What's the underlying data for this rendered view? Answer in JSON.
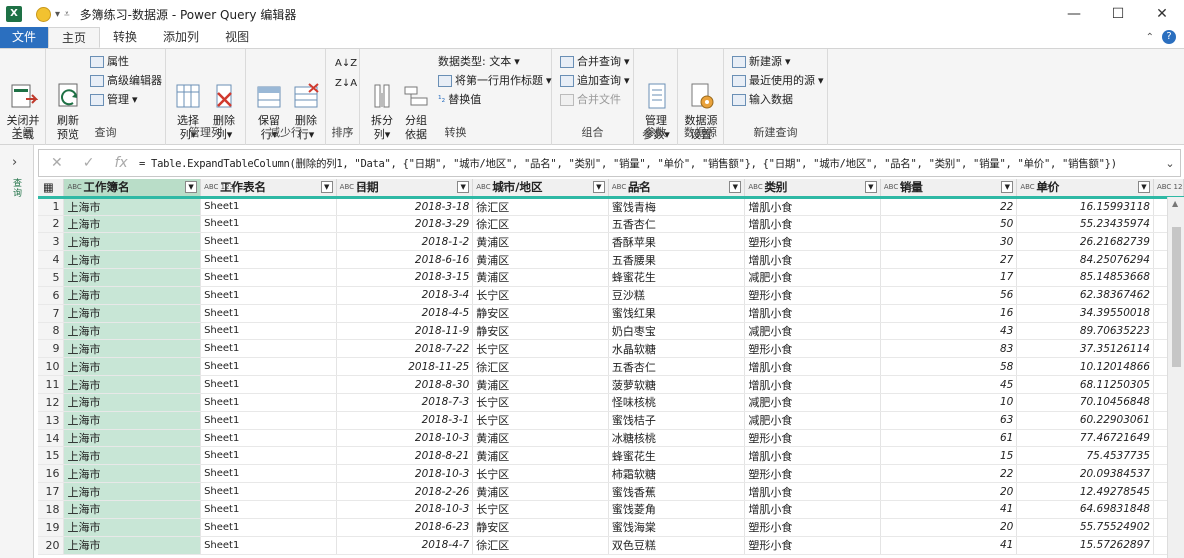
{
  "window": {
    "title": "多簿练习-数据源 - Power Query 编辑器",
    "app_icon": "X"
  },
  "tabs": [
    {
      "label": "文件"
    },
    {
      "label": "主页"
    },
    {
      "label": "转换"
    },
    {
      "label": "添加列"
    },
    {
      "label": "视图"
    }
  ],
  "ribbon": {
    "close_load": "关闭并\n上载",
    "close_group": "关闭",
    "refresh_preview": "刷新\n预览",
    "properties": "属性",
    "advanced_editor": "高级编辑器",
    "manage": "管理",
    "query_group": "查询",
    "choose_columns": "选择\n列",
    "remove_columns": "删除\n列",
    "manage_columns_group": "管理列",
    "keep_rows": "保留\n行",
    "remove_rows": "删除\n行",
    "reduce_rows_group": "减少行",
    "sort_group": "排序",
    "split_column": "拆分\n列",
    "group_by": "分组\n依据",
    "data_type": "数据类型: 文本",
    "first_row_header": "将第一行用作标题",
    "replace_values": "替换值",
    "transform_group": "转换",
    "merge_queries": "合并查询",
    "append_queries": "追加查询",
    "merge_files": "合并文件",
    "combine_group": "组合",
    "manage_params": "管理\n参数",
    "params_group": "参数",
    "data_source_settings": "数据源\n设置",
    "data_source_group": "数据源",
    "new_source": "新建源",
    "recent_sources": "最近使用的源",
    "enter_data": "输入数据",
    "new_query_group": "新建查询"
  },
  "left_pane": {
    "label": "查询"
  },
  "formula": "= Table.ExpandTableColumn(删除的列1, \"Data\", {\"日期\", \"城市/地区\", \"品名\", \"类别\", \"销量\", \"单价\", \"销售额\"}, {\"日期\", \"城市/地区\", \"品名\", \"类别\", \"销量\", \"单价\", \"销售额\"})",
  "columns": [
    {
      "type": "ABC",
      "name": "工作簿名"
    },
    {
      "type": "ABC 123",
      "name": "工作表名"
    },
    {
      "type": "ABC 123",
      "name": "日期"
    },
    {
      "type": "ABC 123",
      "name": "城市/地区"
    },
    {
      "type": "ABC 123",
      "name": "品名"
    },
    {
      "type": "ABC 123",
      "name": "类别"
    },
    {
      "type": "ABC 123",
      "name": "销量"
    },
    {
      "type": "ABC 123",
      "name": "单价"
    },
    {
      "type": "ABC 123",
      "name": ""
    }
  ],
  "rows": [
    [
      "1",
      "上海市",
      "Sheet1",
      "2018-3-18",
      "徐汇区",
      "蜜饯青梅",
      "增肌小食",
      "22",
      "16.15993118"
    ],
    [
      "2",
      "上海市",
      "Sheet1",
      "2018-3-29",
      "徐汇区",
      "五香杏仁",
      "增肌小食",
      "50",
      "55.23435974"
    ],
    [
      "3",
      "上海市",
      "Sheet1",
      "2018-1-2",
      "黄浦区",
      "香酥苹果",
      "塑形小食",
      "30",
      "26.21682739"
    ],
    [
      "4",
      "上海市",
      "Sheet1",
      "2018-6-16",
      "黄浦区",
      "五香腰果",
      "增肌小食",
      "27",
      "84.25076294"
    ],
    [
      "5",
      "上海市",
      "Sheet1",
      "2018-3-15",
      "黄浦区",
      "蜂蜜花生",
      "减肥小食",
      "17",
      "85.14853668"
    ],
    [
      "6",
      "上海市",
      "Sheet1",
      "2018-3-4",
      "长宁区",
      "豆沙糕",
      "塑形小食",
      "56",
      "62.38367462"
    ],
    [
      "7",
      "上海市",
      "Sheet1",
      "2018-4-5",
      "静安区",
      "蜜饯红果",
      "增肌小食",
      "16",
      "34.39550018"
    ],
    [
      "8",
      "上海市",
      "Sheet1",
      "2018-11-9",
      "静安区",
      "奶白枣宝",
      "减肥小食",
      "43",
      "89.70635223"
    ],
    [
      "9",
      "上海市",
      "Sheet1",
      "2018-7-22",
      "长宁区",
      "水晶软糖",
      "塑形小食",
      "83",
      "37.35126114"
    ],
    [
      "10",
      "上海市",
      "Sheet1",
      "2018-11-25",
      "徐汇区",
      "五香杏仁",
      "增肌小食",
      "58",
      "10.12014866"
    ],
    [
      "11",
      "上海市",
      "Sheet1",
      "2018-8-30",
      "黄浦区",
      "菠萝软糖",
      "增肌小食",
      "45",
      "68.11250305"
    ],
    [
      "12",
      "上海市",
      "Sheet1",
      "2018-7-3",
      "长宁区",
      "怪味核桃",
      "减肥小食",
      "10",
      "70.10456848"
    ],
    [
      "13",
      "上海市",
      "Sheet1",
      "2018-3-1",
      "长宁区",
      "蜜饯桔子",
      "减肥小食",
      "63",
      "60.22903061"
    ],
    [
      "14",
      "上海市",
      "Sheet1",
      "2018-10-3",
      "黄浦区",
      "冰糖核桃",
      "塑形小食",
      "61",
      "77.46721649"
    ],
    [
      "15",
      "上海市",
      "Sheet1",
      "2018-8-21",
      "黄浦区",
      "蜂蜜花生",
      "增肌小食",
      "15",
      "75.4537735"
    ],
    [
      "16",
      "上海市",
      "Sheet1",
      "2018-10-3",
      "长宁区",
      "柿霜软糖",
      "塑形小食",
      "22",
      "20.09384537"
    ],
    [
      "17",
      "上海市",
      "Sheet1",
      "2018-2-26",
      "黄浦区",
      "蜜饯香蕉",
      "增肌小食",
      "20",
      "12.49278545"
    ],
    [
      "18",
      "上海市",
      "Sheet1",
      "2018-10-3",
      "长宁区",
      "蜜饯菱角",
      "增肌小食",
      "41",
      "64.69831848"
    ],
    [
      "19",
      "上海市",
      "Sheet1",
      "2018-6-23",
      "静安区",
      "蜜饯海棠",
      "塑形小食",
      "20",
      "55.75524902"
    ],
    [
      "20",
      "上海市",
      "Sheet1",
      "2018-4-7",
      "徐汇区",
      "双色豆糕",
      "塑形小食",
      "41",
      "15.57262897"
    ]
  ]
}
